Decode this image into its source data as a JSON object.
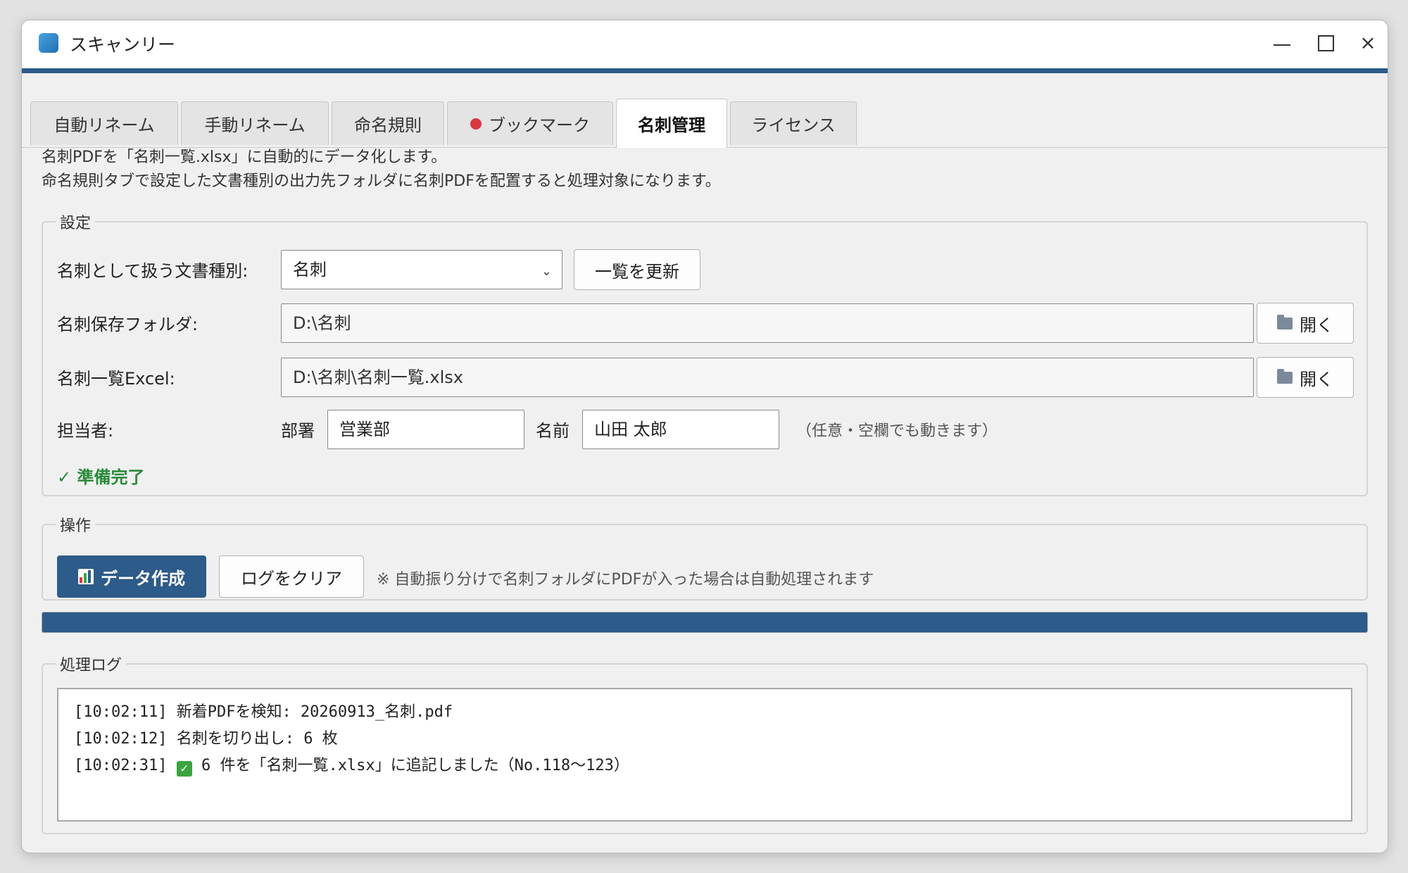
{
  "window": {
    "title": "スキャンリー",
    "controls": {
      "minimize": "minimize",
      "maximize": "maximize",
      "close": "×"
    }
  },
  "tabs": [
    {
      "label": "自動リネーム",
      "active": false
    },
    {
      "label": "手動リネーム",
      "active": false
    },
    {
      "label": "命名規則",
      "active": false
    },
    {
      "label": "ブックマーク",
      "active": false,
      "indicator": "red-dot"
    },
    {
      "label": "名刺管理",
      "active": true
    },
    {
      "label": "ライセンス",
      "active": false
    }
  ],
  "description": {
    "line1": "名刺PDFを「名刺一覧.xlsx」に自動的にデータ化します。",
    "line2": "命名規則タブで設定した文書種別の出力先フォルダに名刺PDFを配置すると処理対象になります。"
  },
  "settings": {
    "legend": "設定",
    "doc_type_label": "名刺として扱う文書種別:",
    "doc_type_value": "名刺",
    "refresh_button": "一覧を更新",
    "folder_label": "名刺保存フォルダ:",
    "folder_value": "D:\\名刺",
    "open_button": "開く",
    "excel_label": "名刺一覧Excel:",
    "excel_value": "D:\\名刺\\名刺一覧.xlsx",
    "owner_label": "担当者:",
    "dept_label": "部署",
    "dept_value": "営業部",
    "name_label": "名前",
    "name_value": "山田 太郎",
    "owner_hint": "（任意・空欄でも動きます）",
    "status": "✓ 準備完了"
  },
  "operations": {
    "legend": "操作",
    "create_button": "データ作成",
    "clear_button": "ログをクリア",
    "note": "※ 自動振り分けで名刺フォルダにPDFが入った場合は自動処理されます"
  },
  "progress": {
    "percent": 100
  },
  "log": {
    "legend": "処理ログ",
    "lines": [
      {
        "time": "[10:02:11]",
        "text": "新着PDFを検知: 20260913_名刺.pdf"
      },
      {
        "time": "[10:02:12]",
        "text": "名刺を切り出し: 6 枚"
      },
      {
        "time": "[10:02:31]",
        "text": "6 件を「名刺一覧.xlsx」に追記しました（No.118〜123）",
        "icon": "check-mark-icon"
      }
    ]
  },
  "colors": {
    "accent": "#2d5b8a",
    "success": "#2a8a3a",
    "bookmark_dot": "#d9363e"
  }
}
